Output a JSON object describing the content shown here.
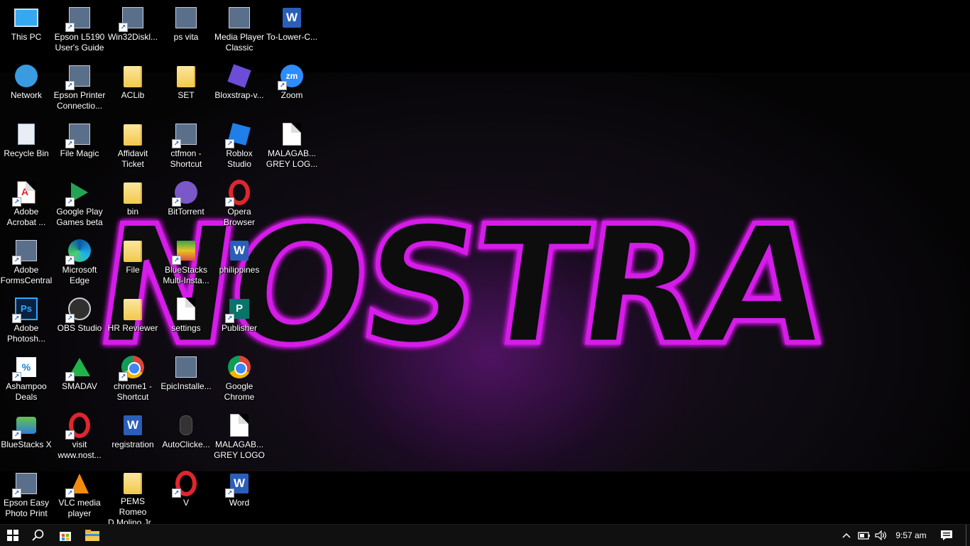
{
  "wallpaper": {
    "text": "NOSTRA",
    "glow_color": "#d51be9"
  },
  "desktop_icons": [
    {
      "label": "This PC",
      "icon": "computer-icon",
      "shortcut": false
    },
    {
      "label": "Network",
      "icon": "network-icon",
      "shortcut": false
    },
    {
      "label": "Recycle Bin",
      "icon": "recycle-bin-icon",
      "shortcut": false
    },
    {
      "label": "Adobe\nAcrobat ...",
      "icon": "adobe-acrobat-icon",
      "shortcut": true
    },
    {
      "label": "Adobe\nFormsCentral",
      "icon": "adobe-formscentral-icon",
      "shortcut": true
    },
    {
      "label": "Adobe\nPhotosh...",
      "icon": "photoshop-icon",
      "shortcut": true
    },
    {
      "label": "Ashampoo\nDeals",
      "icon": "ashampoo-icon",
      "shortcut": true
    },
    {
      "label": "BlueStacks X",
      "icon": "bluestacks-x-icon",
      "shortcut": true
    },
    {
      "label": "Epson Easy\nPhoto Print",
      "icon": "epson-photo-icon",
      "shortcut": true
    },
    {
      "label": "Epson L5190\nUser's Guide",
      "icon": "epson-guide-icon",
      "shortcut": true
    },
    {
      "label": "Epson Printer\nConnectio...",
      "icon": "epson-printer-icon",
      "shortcut": true
    },
    {
      "label": "File Magic",
      "icon": "file-magic-icon",
      "shortcut": true
    },
    {
      "label": "Google Play\nGames beta",
      "icon": "google-play-games-icon",
      "shortcut": true
    },
    {
      "label": "Microsoft\nEdge",
      "icon": "edge-icon",
      "shortcut": true
    },
    {
      "label": "OBS Studio",
      "icon": "obs-icon",
      "shortcut": true
    },
    {
      "label": "SMADAV",
      "icon": "smadav-icon",
      "shortcut": true
    },
    {
      "label": "visit\nwww.nost...",
      "icon": "opera-icon",
      "shortcut": true
    },
    {
      "label": "VLC media\nplayer",
      "icon": "vlc-icon",
      "shortcut": true
    },
    {
      "label": "Win32Diskl...",
      "icon": "win32disk-icon",
      "shortcut": true
    },
    {
      "label": "ACLib",
      "icon": "folder-icon",
      "shortcut": false
    },
    {
      "label": "Affidavit\nTicket",
      "icon": "folder-icon",
      "shortcut": false
    },
    {
      "label": "bin",
      "icon": "folder-icon",
      "shortcut": false
    },
    {
      "label": "File",
      "icon": "folder-icon",
      "shortcut": false
    },
    {
      "label": "HR Reviewer",
      "icon": "folder-icon",
      "shortcut": false
    },
    {
      "label": "chrome1 -\nShortcut",
      "icon": "chrome-icon",
      "shortcut": true
    },
    {
      "label": "registration",
      "icon": "word-doc-icon",
      "shortcut": false
    },
    {
      "label": "PEMS Romeo\nD Molino Jr...",
      "icon": "folder-icon",
      "shortcut": false
    },
    {
      "label": "ps vita",
      "icon": "winrar-icon",
      "shortcut": false
    },
    {
      "label": "SET",
      "icon": "folder-icon",
      "shortcut": false
    },
    {
      "label": "ctfmon -\nShortcut",
      "icon": "ctfmon-icon",
      "shortcut": true
    },
    {
      "label": "BitTorrent",
      "icon": "bittorrent-icon",
      "shortcut": true
    },
    {
      "label": "BlueStacks\nMulti-Insta...",
      "icon": "bluestacks-multi-icon",
      "shortcut": true
    },
    {
      "label": "settings",
      "icon": "blank-file-icon",
      "shortcut": false
    },
    {
      "label": "EpicInstalle...",
      "icon": "epic-installer-icon",
      "shortcut": false
    },
    {
      "label": "AutoClicke...",
      "icon": "mouse-icon",
      "shortcut": false
    },
    {
      "label": "V",
      "icon": "opera-icon",
      "shortcut": true
    },
    {
      "label": "Media Player\nClassic",
      "icon": "media-player-classic-icon",
      "shortcut": false
    },
    {
      "label": "Bloxstrap-v...",
      "icon": "bloxstrap-icon",
      "shortcut": false
    },
    {
      "label": "Roblox\nStudio",
      "icon": "roblox-studio-icon",
      "shortcut": true
    },
    {
      "label": "Opera\nBrowser",
      "icon": "opera-icon",
      "shortcut": true
    },
    {
      "label": "philippines",
      "icon": "word-doc-icon",
      "shortcut": false
    },
    {
      "label": "Publisher",
      "icon": "publisher-icon",
      "shortcut": true
    },
    {
      "label": "Google\nChrome",
      "icon": "chrome-icon",
      "shortcut": false
    },
    {
      "label": "MALAGAB...\nGREY LOGO",
      "icon": "image-file-icon",
      "shortcut": false
    },
    {
      "label": "Word",
      "icon": "word-icon",
      "shortcut": true
    },
    {
      "label": "To-Lower-C...",
      "icon": "word-doc-icon",
      "shortcut": false
    },
    {
      "label": "Zoom",
      "icon": "zoom-icon",
      "shortcut": true
    },
    {
      "label": "MALAGAB...\nGREY LOG...",
      "icon": "image-file-icon",
      "shortcut": false
    }
  ],
  "taskbar": {
    "start": "windows-logo-icon",
    "search": "search-icon",
    "store": "microsoft-store-icon",
    "explorer": "file-explorer-icon",
    "clock": "9:57 am",
    "tray": [
      "chevron-up-icon",
      "battery-icon",
      "speaker-icon",
      "notification-icon"
    ]
  }
}
